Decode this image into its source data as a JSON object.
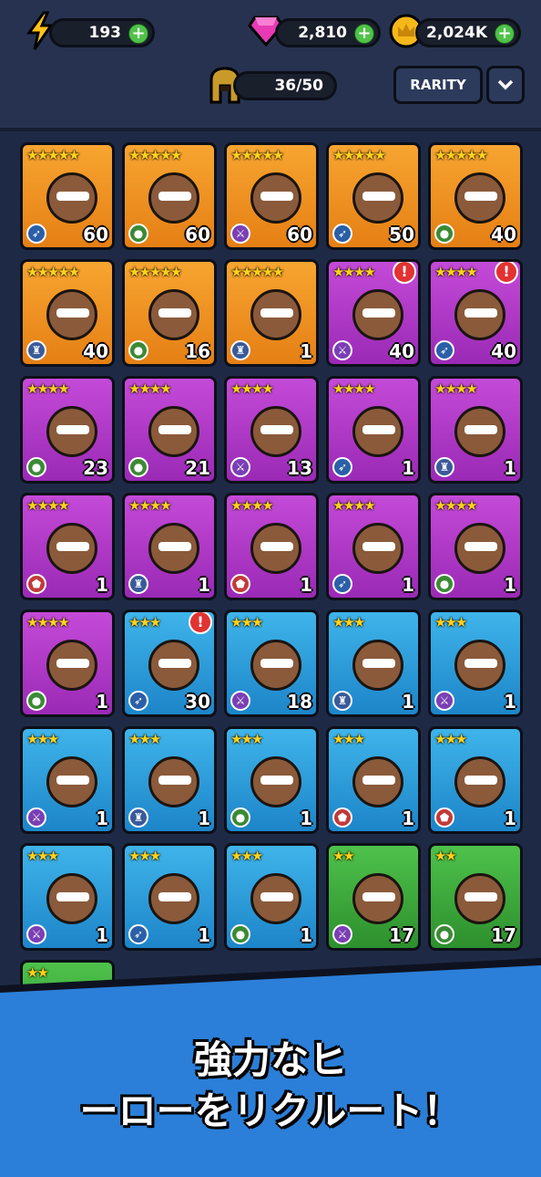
{
  "hud": {
    "energy": "193",
    "gems": "2,810",
    "gold": "2,024K",
    "roster": "36/50",
    "rarity_label": "RARITY",
    "colors": {
      "energy": "#ffc21a",
      "gem": "#e83ab5",
      "gold": "#f5b81a",
      "plus": "#4fc24a"
    }
  },
  "heroes": [
    {
      "rarity": "legend",
      "stars": "★★★★★",
      "class": "bow",
      "level": "60",
      "alert": false
    },
    {
      "rarity": "legend",
      "stars": "★★★★★",
      "class": "bomb",
      "level": "60",
      "alert": false
    },
    {
      "rarity": "legend",
      "stars": "★★★★★",
      "class": "sword",
      "level": "60",
      "alert": false
    },
    {
      "rarity": "legend",
      "stars": "★★★★★",
      "class": "bow",
      "level": "50",
      "alert": false
    },
    {
      "rarity": "legend",
      "stars": "★★★★★",
      "class": "bomb",
      "level": "40",
      "alert": false
    },
    {
      "rarity": "legend",
      "stars": "★★★★★",
      "class": "tower",
      "level": "40",
      "alert": false
    },
    {
      "rarity": "legend",
      "stars": "★★★★★",
      "class": "bomb",
      "level": "16",
      "alert": false
    },
    {
      "rarity": "legend",
      "stars": "★★★★★",
      "class": "tower",
      "level": "1",
      "alert": false
    },
    {
      "rarity": "epic",
      "stars": "★★★★",
      "class": "sword",
      "level": "40",
      "alert": true
    },
    {
      "rarity": "epic",
      "stars": "★★★★",
      "class": "bow",
      "level": "40",
      "alert": true
    },
    {
      "rarity": "epic",
      "stars": "★★★★",
      "class": "bomb",
      "level": "23",
      "alert": false
    },
    {
      "rarity": "epic",
      "stars": "★★★★",
      "class": "bomb",
      "level": "21",
      "alert": false
    },
    {
      "rarity": "epic",
      "stars": "★★★★",
      "class": "sword",
      "level": "13",
      "alert": false
    },
    {
      "rarity": "epic",
      "stars": "★★★★",
      "class": "bow",
      "level": "1",
      "alert": false
    },
    {
      "rarity": "epic",
      "stars": "★★★★",
      "class": "tower",
      "level": "1",
      "alert": false
    },
    {
      "rarity": "epic",
      "stars": "★★★★",
      "class": "shield",
      "level": "1",
      "alert": false
    },
    {
      "rarity": "epic",
      "stars": "★★★★",
      "class": "tower",
      "level": "1",
      "alert": false
    },
    {
      "rarity": "epic",
      "stars": "★★★★",
      "class": "shield",
      "level": "1",
      "alert": false
    },
    {
      "rarity": "epic",
      "stars": "★★★★",
      "class": "bow",
      "level": "1",
      "alert": false
    },
    {
      "rarity": "epic",
      "stars": "★★★★",
      "class": "bomb",
      "level": "1",
      "alert": false
    },
    {
      "rarity": "epic",
      "stars": "★★★★",
      "class": "bomb",
      "level": "1",
      "alert": false
    },
    {
      "rarity": "rare",
      "stars": "★★★",
      "class": "bow",
      "level": "30",
      "alert": true
    },
    {
      "rarity": "rare",
      "stars": "★★★",
      "class": "sword",
      "level": "18",
      "alert": false
    },
    {
      "rarity": "rare",
      "stars": "★★★",
      "class": "tower",
      "level": "1",
      "alert": false
    },
    {
      "rarity": "rare",
      "stars": "★★★",
      "class": "sword",
      "level": "1",
      "alert": false
    },
    {
      "rarity": "rare",
      "stars": "★★★",
      "class": "sword",
      "level": "1",
      "alert": false
    },
    {
      "rarity": "rare",
      "stars": "★★★",
      "class": "tower",
      "level": "1",
      "alert": false
    },
    {
      "rarity": "rare",
      "stars": "★★★",
      "class": "bomb",
      "level": "1",
      "alert": false
    },
    {
      "rarity": "rare",
      "stars": "★★★",
      "class": "shield",
      "level": "1",
      "alert": false
    },
    {
      "rarity": "rare",
      "stars": "★★★",
      "class": "shield",
      "level": "1",
      "alert": false
    },
    {
      "rarity": "rare",
      "stars": "★★★",
      "class": "sword",
      "level": "1",
      "alert": false
    },
    {
      "rarity": "rare",
      "stars": "★★★",
      "class": "bow",
      "level": "1",
      "alert": false
    },
    {
      "rarity": "rare",
      "stars": "★★★",
      "class": "bomb",
      "level": "1",
      "alert": false
    },
    {
      "rarity": "uncommon",
      "stars": "★★",
      "class": "sword",
      "level": "17",
      "alert": false
    },
    {
      "rarity": "uncommon",
      "stars": "★★",
      "class": "bomb",
      "level": "17",
      "alert": false
    },
    {
      "rarity": "uncommon",
      "stars": "★★",
      "class": "",
      "level": "",
      "alert": false
    }
  ],
  "class_colors": {
    "bow": "#2b5fa8",
    "bomb": "#3b8a35",
    "sword": "#7a3fb5",
    "tower": "#3a5a9a",
    "shield": "#c23a3a"
  },
  "banner": {
    "line1": "強力なヒ",
    "line2": "ーローをリクルート！"
  }
}
